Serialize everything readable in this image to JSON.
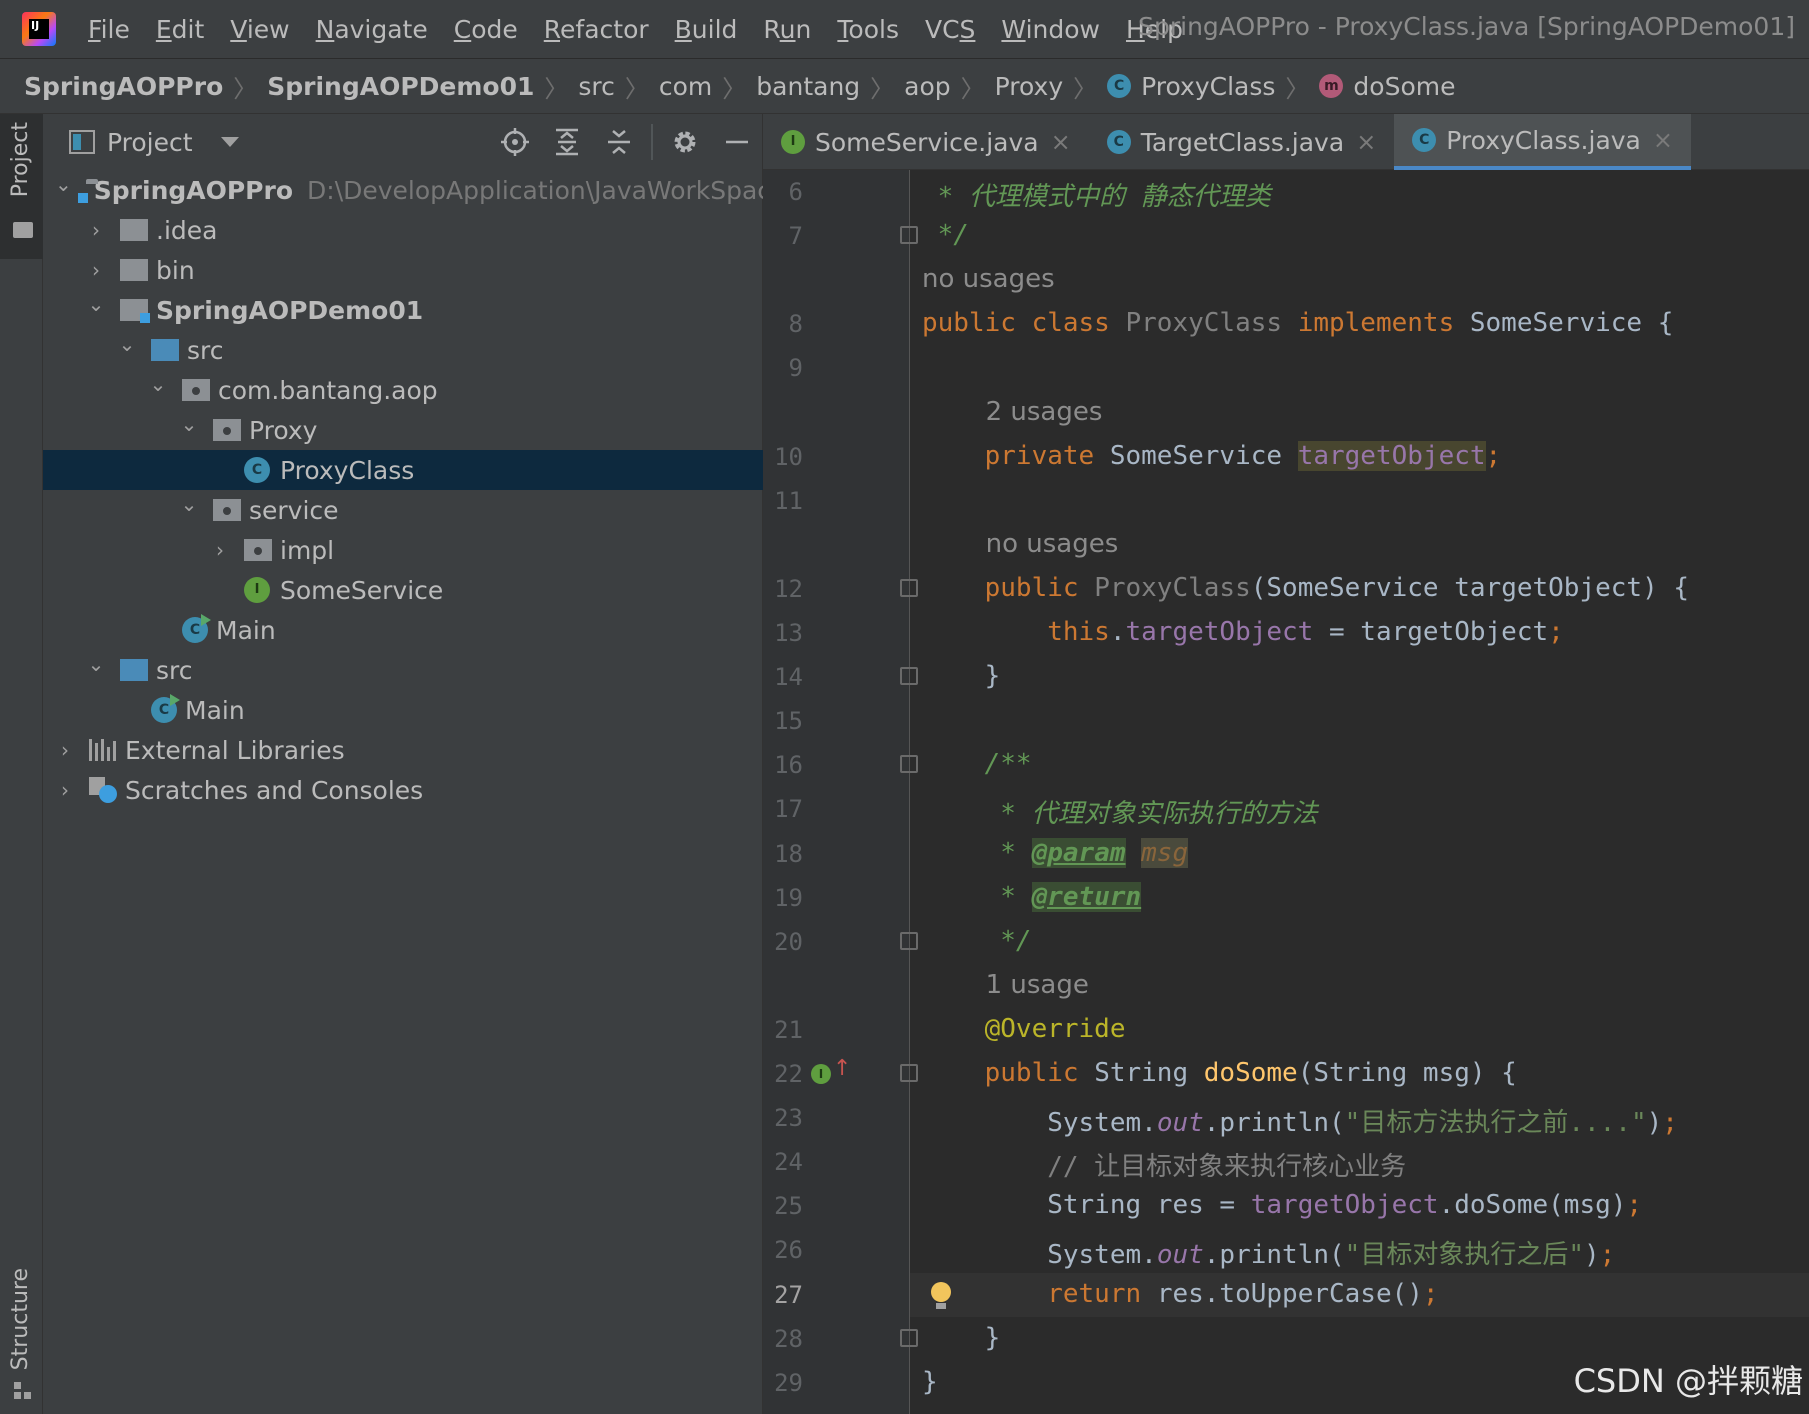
{
  "menu": {
    "items": [
      {
        "label": "File",
        "mnemonic": "F"
      },
      {
        "label": "Edit",
        "mnemonic": "E"
      },
      {
        "label": "View",
        "mnemonic": "V"
      },
      {
        "label": "Navigate",
        "mnemonic": "N"
      },
      {
        "label": "Code",
        "mnemonic": "C"
      },
      {
        "label": "Refactor",
        "mnemonic": "R"
      },
      {
        "label": "Build",
        "mnemonic": "B"
      },
      {
        "label": "Run",
        "mnemonic": "u"
      },
      {
        "label": "Tools",
        "mnemonic": "T"
      },
      {
        "label": "VCS",
        "mnemonic": "S"
      },
      {
        "label": "Window",
        "mnemonic": "W"
      },
      {
        "label": "Help",
        "mnemonic": "H"
      }
    ],
    "window_title": "SpringAOPPro - ProxyClass.java [SpringAOPDemo01]"
  },
  "breadcrumbs": [
    {
      "label": "SpringAOPPro",
      "bold": true,
      "icon": ""
    },
    {
      "label": "SpringAOPDemo01",
      "bold": true,
      "icon": ""
    },
    {
      "label": "src",
      "bold": false,
      "icon": ""
    },
    {
      "label": "com",
      "bold": false,
      "icon": ""
    },
    {
      "label": "bantang",
      "bold": false,
      "icon": ""
    },
    {
      "label": "aop",
      "bold": false,
      "icon": ""
    },
    {
      "label": "Proxy",
      "bold": false,
      "icon": ""
    },
    {
      "label": "ProxyClass",
      "bold": false,
      "icon": "class-icon"
    },
    {
      "label": "doSome",
      "bold": false,
      "icon": "method-icon"
    }
  ],
  "toolstrip": {
    "project_label": "Project",
    "structure_label": "Structure"
  },
  "project_panel": {
    "title": "Project",
    "tools": [
      "locate-icon",
      "expand-all-icon",
      "collapse-all-icon",
      "gear-icon",
      "hide-icon"
    ],
    "tree": [
      {
        "level": 0,
        "expanded": true,
        "icon": "module-folder",
        "label": "SpringAOPPro",
        "bold": true,
        "sub": "D:\\DevelopApplication\\JavaWorkSpace\\",
        "selected": false
      },
      {
        "level": 1,
        "expanded": false,
        "icon": "folder",
        "label": ".idea",
        "bold": false,
        "sub": "",
        "selected": false
      },
      {
        "level": 1,
        "expanded": false,
        "icon": "folder",
        "label": "bin",
        "bold": false,
        "sub": "",
        "selected": false
      },
      {
        "level": 1,
        "expanded": true,
        "icon": "module-folder",
        "label": "SpringAOPDemo01",
        "bold": true,
        "sub": "",
        "selected": false
      },
      {
        "level": 2,
        "expanded": true,
        "icon": "source-folder",
        "label": "src",
        "bold": false,
        "sub": "",
        "selected": false
      },
      {
        "level": 3,
        "expanded": true,
        "icon": "package",
        "label": "com.bantang.aop",
        "bold": false,
        "sub": "",
        "selected": false
      },
      {
        "level": 4,
        "expanded": true,
        "icon": "package",
        "label": "Proxy",
        "bold": false,
        "sub": "",
        "selected": false
      },
      {
        "level": 5,
        "expanded": null,
        "icon": "class",
        "label": "ProxyClass",
        "bold": false,
        "sub": "",
        "selected": true
      },
      {
        "level": 4,
        "expanded": true,
        "icon": "package",
        "label": "service",
        "bold": false,
        "sub": "",
        "selected": false
      },
      {
        "level": 5,
        "expanded": false,
        "icon": "package",
        "label": "impl",
        "bold": false,
        "sub": "",
        "selected": false
      },
      {
        "level": 5,
        "expanded": null,
        "icon": "interface",
        "label": "SomeService",
        "bold": false,
        "sub": "",
        "selected": false
      },
      {
        "level": 3,
        "expanded": null,
        "icon": "main-class",
        "label": "Main",
        "bold": false,
        "sub": "",
        "selected": false
      },
      {
        "level": 1,
        "expanded": true,
        "icon": "source-folder",
        "label": "src",
        "bold": false,
        "sub": "",
        "selected": false
      },
      {
        "level": 2,
        "expanded": null,
        "icon": "main-class",
        "label": "Main",
        "bold": false,
        "sub": "",
        "selected": false
      },
      {
        "level": 0,
        "expanded": false,
        "icon": "libraries",
        "label": "External Libraries",
        "bold": false,
        "sub": "",
        "selected": false
      },
      {
        "level": 0,
        "expanded": false,
        "icon": "scratches",
        "label": "Scratches and Consoles",
        "bold": false,
        "sub": "",
        "selected": false
      }
    ]
  },
  "editor": {
    "tabs": [
      {
        "label": "SomeService.java",
        "icon": "interface-icon",
        "active": false
      },
      {
        "label": "TargetClass.java",
        "icon": "class-icon",
        "active": false
      },
      {
        "label": "ProxyClass.java",
        "icon": "class-icon",
        "active": true
      }
    ],
    "current_line": "27",
    "rows": [
      {
        "num": "6",
        "inlay": "",
        "fold": false,
        "tokens": [
          [
            " * 代理模式中的 静态代理类",
            "doc"
          ]
        ]
      },
      {
        "num": "7",
        "inlay": "",
        "fold": true,
        "tokens": [
          [
            " */",
            "doc"
          ]
        ]
      },
      {
        "num": "",
        "inlay": "no usages",
        "indent": 0,
        "fold": false,
        "tokens": []
      },
      {
        "num": "8",
        "inlay": "",
        "fold": false,
        "tokens": [
          [
            "public class ",
            "kw"
          ],
          [
            "ProxyClass ",
            "cls-gray"
          ],
          [
            "implements ",
            "kw"
          ],
          [
            "SomeService {",
            ""
          ]
        ]
      },
      {
        "num": "9",
        "inlay": "",
        "fold": false,
        "tokens": []
      },
      {
        "num": "",
        "inlay": "2 usages",
        "indent": 4,
        "fold": false,
        "tokens": []
      },
      {
        "num": "10",
        "inlay": "",
        "fold": false,
        "tokens": [
          [
            "    private ",
            "kw"
          ],
          [
            "SomeService ",
            ""
          ],
          [
            "targetObject",
            "hl-field"
          ],
          [
            ";",
            "kw"
          ]
        ]
      },
      {
        "num": "11",
        "inlay": "",
        "fold": false,
        "tokens": []
      },
      {
        "num": "",
        "inlay": "no usages",
        "indent": 4,
        "fold": false,
        "tokens": []
      },
      {
        "num": "12",
        "inlay": "",
        "fold": true,
        "tokens": [
          [
            "    public ",
            "kw"
          ],
          [
            "ProxyClass",
            "cls-gray"
          ],
          [
            "(SomeService targetObject) {",
            ""
          ]
        ]
      },
      {
        "num": "13",
        "inlay": "",
        "fold": false,
        "tokens": [
          [
            "        this",
            "kw"
          ],
          [
            ".",
            ""
          ],
          [
            "targetObject",
            "field"
          ],
          [
            " = targetObject",
            ""
          ],
          [
            ";",
            "kw"
          ]
        ]
      },
      {
        "num": "14",
        "inlay": "",
        "fold": true,
        "tokens": [
          [
            "    }",
            ""
          ]
        ]
      },
      {
        "num": "15",
        "inlay": "",
        "fold": false,
        "tokens": []
      },
      {
        "num": "16",
        "inlay": "",
        "fold": true,
        "tokens": [
          [
            "    /**",
            "doc"
          ]
        ]
      },
      {
        "num": "17",
        "inlay": "",
        "fold": false,
        "tokens": [
          [
            "     * 代理对象实际执行的方法",
            "doc"
          ]
        ]
      },
      {
        "num": "18",
        "inlay": "",
        "fold": false,
        "tokens": [
          [
            "     * ",
            "doc"
          ],
          [
            "@param",
            "doctag"
          ],
          [
            " ",
            "doc"
          ],
          [
            "msg",
            "docparam"
          ]
        ]
      },
      {
        "num": "19",
        "inlay": "",
        "fold": false,
        "tokens": [
          [
            "     * ",
            "doc"
          ],
          [
            "@return",
            "doctag"
          ]
        ]
      },
      {
        "num": "20",
        "inlay": "",
        "fold": true,
        "tokens": [
          [
            "     */",
            "doc"
          ]
        ]
      },
      {
        "num": "",
        "inlay": "1 usage",
        "indent": 4,
        "fold": false,
        "tokens": []
      },
      {
        "num": "21",
        "inlay": "",
        "fold": false,
        "tokens": [
          [
            "    @Override",
            "anno"
          ]
        ]
      },
      {
        "num": "22",
        "inlay": "",
        "fold": true,
        "impl": true,
        "tokens": [
          [
            "    public ",
            "kw"
          ],
          [
            "String ",
            ""
          ],
          [
            "doSome",
            "method"
          ],
          [
            "(String msg) {",
            ""
          ]
        ]
      },
      {
        "num": "23",
        "inlay": "",
        "fold": false,
        "tokens": [
          [
            "        System.",
            ""
          ],
          [
            "out",
            "static"
          ],
          [
            ".println(",
            ""
          ],
          [
            "\"目标方法执行之前....\"",
            "str"
          ],
          [
            ")",
            ""
          ],
          [
            ";",
            "kw"
          ]
        ]
      },
      {
        "num": "24",
        "inlay": "",
        "fold": false,
        "tokens": [
          [
            "        // 让目标对象来执行核心业务",
            "cmt"
          ]
        ]
      },
      {
        "num": "25",
        "inlay": "",
        "fold": false,
        "tokens": [
          [
            "        String res = ",
            ""
          ],
          [
            "targetObject",
            "field"
          ],
          [
            ".doSome(msg)",
            ""
          ],
          [
            ";",
            "kw"
          ]
        ]
      },
      {
        "num": "26",
        "inlay": "",
        "fold": false,
        "tokens": [
          [
            "        System.",
            ""
          ],
          [
            "out",
            "static"
          ],
          [
            ".println(",
            ""
          ],
          [
            "\"目标对象执行之后\"",
            "str"
          ],
          [
            ")",
            ""
          ],
          [
            ";",
            "kw"
          ]
        ]
      },
      {
        "num": "27",
        "inlay": "",
        "fold": false,
        "bulb": true,
        "tokens": [
          [
            "        return ",
            "kw"
          ],
          [
            "res.toUpperCase()",
            ""
          ],
          [
            ";",
            "kw"
          ]
        ]
      },
      {
        "num": "28",
        "inlay": "",
        "fold": true,
        "tokens": [
          [
            "    }",
            ""
          ]
        ]
      },
      {
        "num": "29",
        "inlay": "",
        "fold": false,
        "tokens": [
          [
            "}",
            ""
          ]
        ]
      }
    ]
  },
  "watermark": "CSDN @拌颗糖"
}
